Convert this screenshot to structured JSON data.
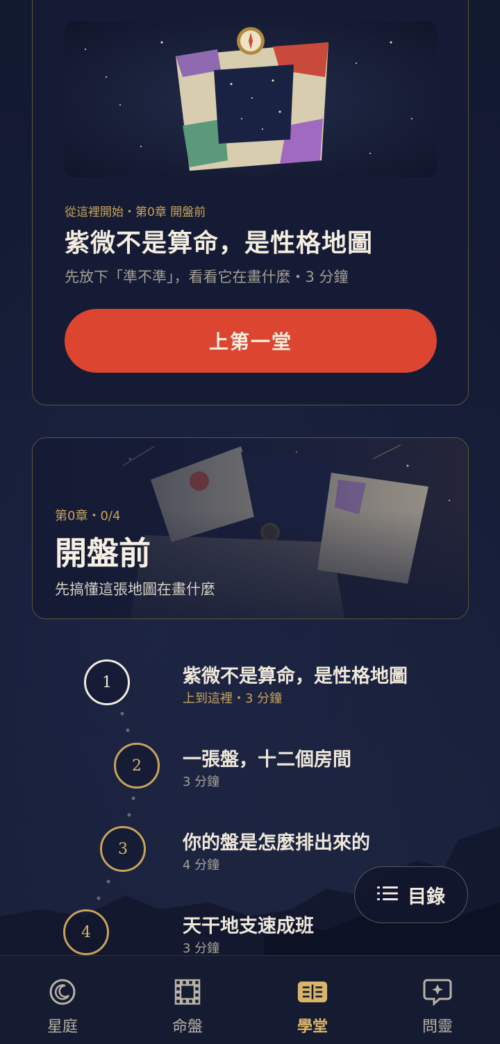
{
  "featured_lesson": {
    "kicker": "從這裡開始・第0章 開盤前",
    "title": "紫微不是算命，是性格地圖",
    "subtitle": "先放下「準不準」，看看它在畫什麼・3 分鐘",
    "cta_label": "上第一堂"
  },
  "chapter": {
    "kicker": "第0章・0/4",
    "title": "開盤前",
    "subtitle": "先搞懂這張地圖在畫什麼"
  },
  "lessons": [
    {
      "number": "1",
      "title": "紫微不是算命，是性格地圖",
      "meta": "上到這裡・3 分鐘",
      "current": true
    },
    {
      "number": "2",
      "title": "一張盤，十二個房間",
      "meta": "3 分鐘",
      "current": false
    },
    {
      "number": "3",
      "title": "你的盤是怎麼排出來的",
      "meta": "4 分鐘",
      "current": false
    },
    {
      "number": "4",
      "title": "天干地支速成班",
      "meta": "3 分鐘",
      "current": false
    }
  ],
  "toc_button": {
    "label": "目錄",
    "icon": "list-icon"
  },
  "bottom_nav": [
    {
      "label": "星庭",
      "icon": "moon-icon",
      "active": false
    },
    {
      "label": "命盤",
      "icon": "grid-chart-icon",
      "active": false
    },
    {
      "label": "學堂",
      "icon": "book-icon",
      "active": true
    },
    {
      "label": "問靈",
      "icon": "chat-star-icon",
      "active": false
    }
  ],
  "colors": {
    "background": "#111830",
    "accent_gold": "#c9a35a",
    "cta_red": "#dc4530",
    "text_primary": "#f4ede0"
  }
}
